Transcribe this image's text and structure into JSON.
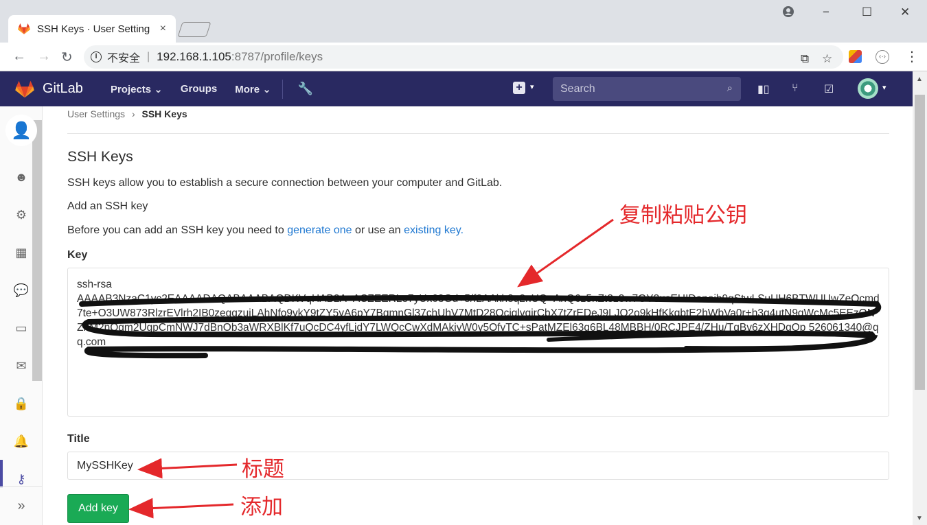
{
  "browser": {
    "tab_title": "SSH Keys · User Setting",
    "tab_close": "×",
    "security_label": "不安全",
    "url_host": "192.168.1.105",
    "url_rest": ":8787/profile/keys",
    "window_controls": [
      "−",
      "☐",
      "✕"
    ]
  },
  "gitlab": {
    "brand": "GitLab",
    "nav": [
      "Projects ⌄",
      "Groups",
      "More ⌄"
    ],
    "search_placeholder": "Search"
  },
  "breadcrumb": {
    "parent": "User Settings",
    "separator": "›",
    "current": "SSH Keys"
  },
  "content": {
    "title": "SSH Keys",
    "description": "SSH keys allow you to establish a secure connection between your computer and GitLab.",
    "add_heading": "Add an SSH key",
    "before_text": "Before you can add an SSH key you need to",
    "generate_link": "generate one",
    "or_text": "or use an",
    "existing_link": "existing key."
  },
  "form": {
    "key_label": "Key",
    "key_prefix": "ssh-rsa",
    "key_value": "AAAAB3NzaC1yc2EAAAADAQABAAABAQDKVqHAB2A+ACZEERLe7yUx03Gd+5/f2AAkh8q2nUQ+AnQ6z5nZt3z3w7GY3usEHIDanoib9qStwLSuUH6BTWUUwZeOcmd7te+O3UW873RlzrEVlrh2IB0zeggzuiLAhNfo9vkY9tZY5yA6pY7BqmnGl37chUhV7MtD28OcjglvqjrCbX7tZrEDeJ9LJO2o9kHfKkgbtE2hWbVa0r+h3q4utN9qWcMc5EEzONZnM2nQgm2UgpCmNWJ7dBnOb3aWRXBlKf7uQcDC4yfLjdY7LWQcCwXdMAkiyW0y5OfvTC+sPatMZEl63q6BL48MBBH/0RCJPE4/ZHu/TqBv6zXHDgQp",
    "key_comment": "526061340@qq.com",
    "title_label": "Title",
    "title_value": "MySSHKey",
    "submit_label": "Add key"
  },
  "annotations": {
    "copy_paste": "复制粘贴公钥",
    "title_note": "标题",
    "add_note": "添加",
    "color": "#e4282b"
  },
  "colors": {
    "header_bg": "#292961",
    "link": "#1f78d1",
    "button_green": "#1aaa55"
  }
}
